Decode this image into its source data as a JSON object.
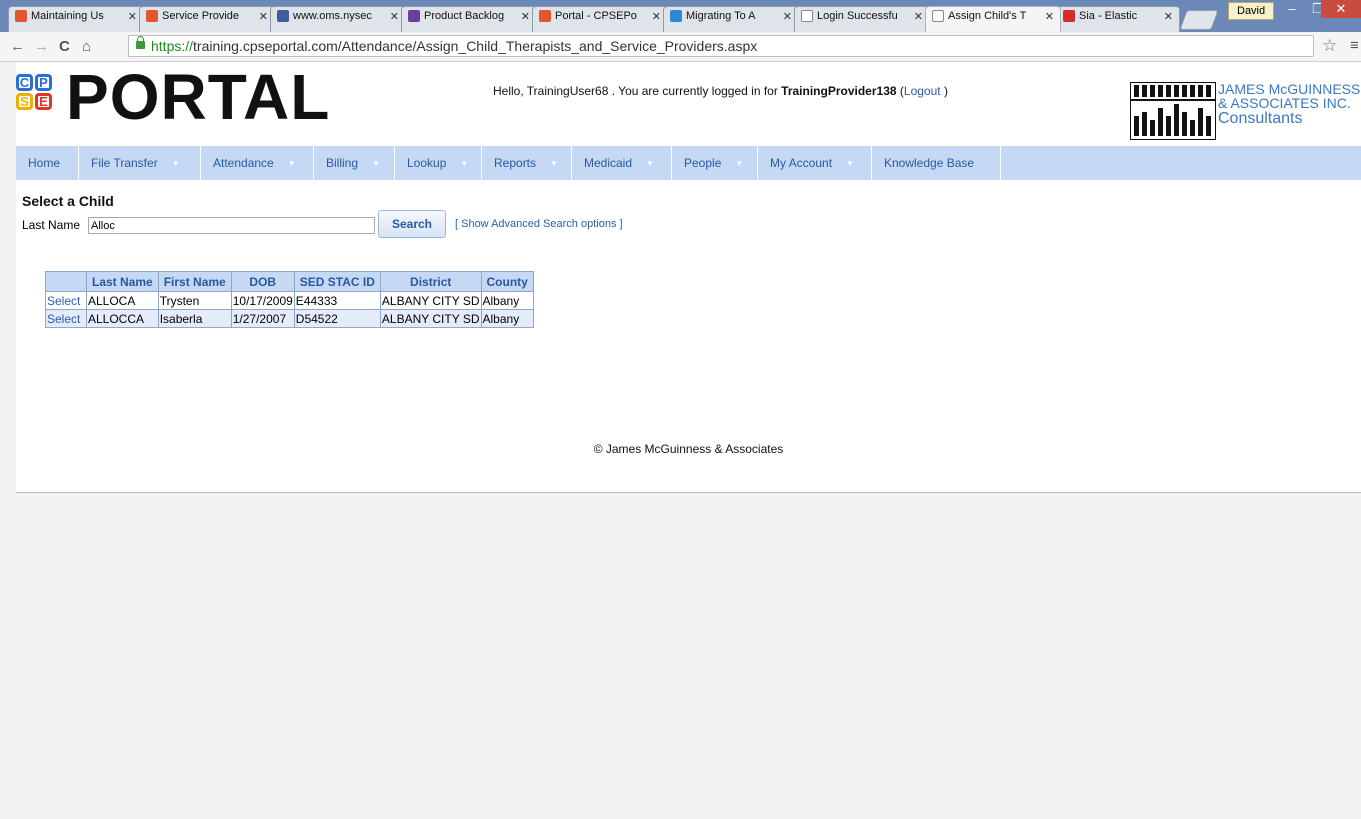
{
  "browser": {
    "tabs": [
      {
        "title": "Maintaining Us",
        "fav": "#e3562f"
      },
      {
        "title": "Service Provide",
        "fav": "#e3562f"
      },
      {
        "title": "www.oms.nysec",
        "fav": "#3b5f9d"
      },
      {
        "title": "Product Backlog",
        "fav": "#6b3fa0"
      },
      {
        "title": "Portal - CPSEPo",
        "fav": "#e3562f"
      },
      {
        "title": "Migrating To A",
        "fav": "#2a8ad8"
      },
      {
        "title": "Login Successfu",
        "fav": "#ffffff"
      },
      {
        "title": "Assign Child's T",
        "fav": "#ffffff"
      },
      {
        "title": "Sia - Elastic",
        "fav": "#d82a2a"
      }
    ],
    "user": "David",
    "url_scheme": "https://",
    "url_rest": "training.cpseportal.com/Attendance/Assign_Child_Therapists_and_Service_Providers.aspx"
  },
  "header": {
    "logo_word": "PORTAL",
    "logo_letters": [
      "C",
      "P",
      "S",
      "E"
    ],
    "hello_prefix": "Hello, TrainingUser68 . You are currently logged in for ",
    "provider": "TrainingProvider138",
    "logout_open": " (",
    "logout": "Logout",
    "logout_close": " )",
    "company_line1": "JAMES McGUINNESS",
    "company_line2": "& ASSOCIATES INC.",
    "company_line3": "Consultants"
  },
  "menu": [
    {
      "label": "Home",
      "caret": false
    },
    {
      "label": "File Transfer",
      "caret": true
    },
    {
      "label": "Attendance",
      "caret": true
    },
    {
      "label": "Billing",
      "caret": true
    },
    {
      "label": "Lookup",
      "caret": true
    },
    {
      "label": "Reports",
      "caret": true
    },
    {
      "label": "Medicaid",
      "caret": true
    },
    {
      "label": "People",
      "caret": true
    },
    {
      "label": "My Account",
      "caret": true
    },
    {
      "label": "Knowledge Base",
      "caret": false
    }
  ],
  "search": {
    "heading": "Select a Child",
    "last_name_label": "Last Name",
    "last_name_value": "Alloc",
    "button": "Search",
    "advanced_link": "[ Show Advanced Search options ]"
  },
  "results": {
    "columns": [
      "",
      "Last Name",
      "First Name",
      "DOB",
      "SED STAC ID",
      "District",
      "County"
    ],
    "rows": [
      {
        "action": "Select",
        "last": "ALLOCA",
        "first": "Trysten",
        "dob": "10/17/2009",
        "id": "E44333",
        "district": "ALBANY CITY SD",
        "county": "Albany"
      },
      {
        "action": "Select",
        "last": "ALLOCCA",
        "first": "Isaberla",
        "dob": "1/27/2007",
        "id": "D54522",
        "district": "ALBANY CITY SD",
        "county": "Albany"
      }
    ]
  },
  "footer": "© James McGuinness & Associates"
}
